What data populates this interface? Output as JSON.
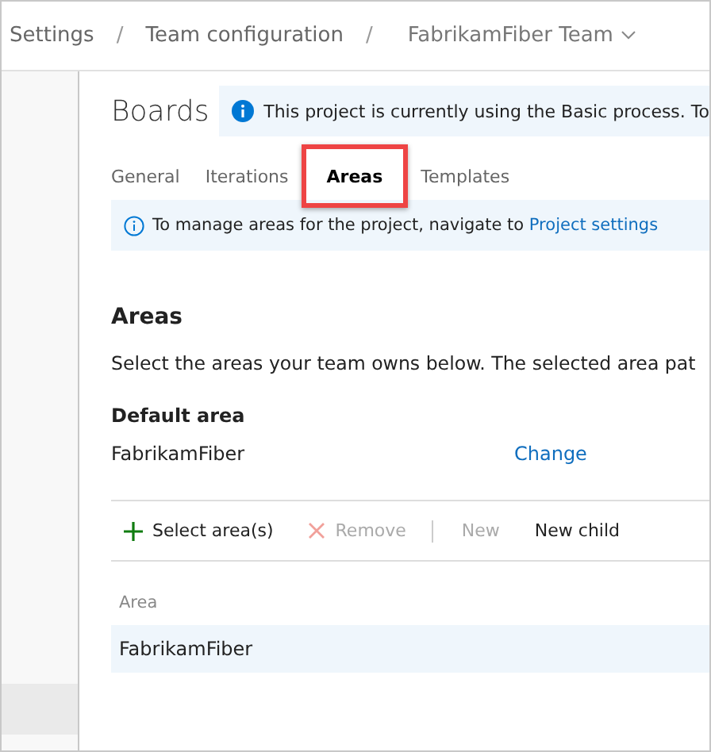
{
  "breadcrumb": {
    "items": [
      {
        "label": "Settings"
      },
      {
        "label": "Team configuration"
      },
      {
        "label": "FabrikamFiber Team",
        "dropdown": true
      }
    ],
    "separator": "/"
  },
  "page": {
    "title": "Boards",
    "banner": "This project is currently using the Basic process. To"
  },
  "tabs": [
    {
      "label": "General",
      "selected": false,
      "highlighted": false
    },
    {
      "label": "Iterations",
      "selected": false,
      "highlighted": false
    },
    {
      "label": "Areas",
      "selected": true,
      "highlighted": true
    },
    {
      "label": "Templates",
      "selected": false,
      "highlighted": false
    }
  ],
  "info": {
    "text": "To manage areas for the project, navigate to ",
    "link": "Project settings"
  },
  "section": {
    "title": "Areas",
    "description": "Select the areas your team owns below. The selected area pat"
  },
  "default_area": {
    "label": "Default area",
    "value": "FabrikamFiber",
    "action": "Change"
  },
  "toolbar": [
    {
      "kind": "add",
      "label": "Select area(s)",
      "disabled": false
    },
    {
      "kind": "remove",
      "label": "Remove",
      "disabled": true
    },
    {
      "kind": "separator"
    },
    {
      "kind": "plain",
      "label": "New",
      "disabled": true
    },
    {
      "kind": "plain",
      "label": "New child",
      "disabled": false
    }
  ],
  "table": {
    "columns": [
      "Area"
    ],
    "rows": [
      {
        "area": "FabrikamFiber",
        "selected": true
      }
    ]
  }
}
